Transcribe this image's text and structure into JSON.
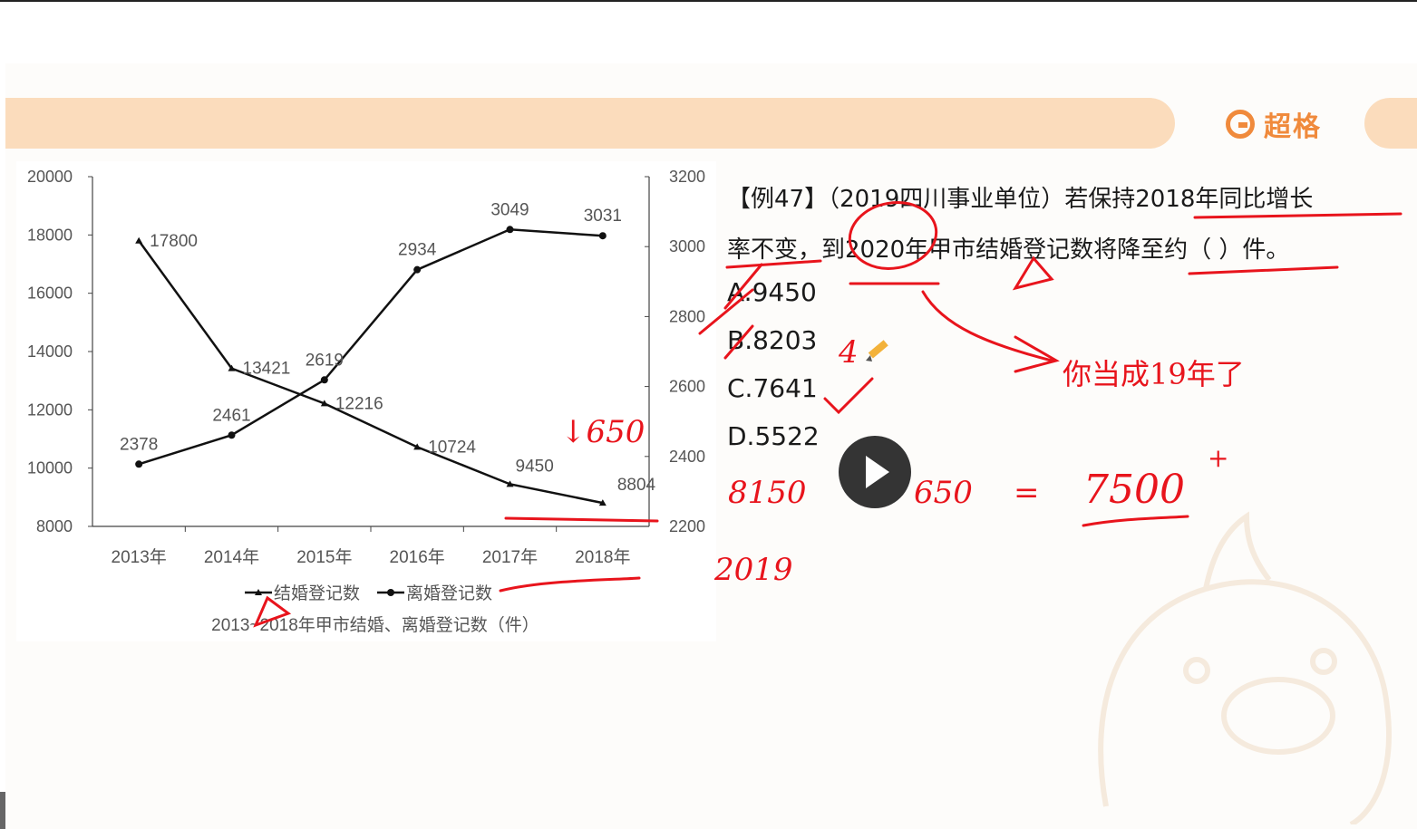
{
  "brand": {
    "name": "超格",
    "accent": "#f08a3c",
    "banner_color": "#fbdcbc"
  },
  "question": {
    "line1": "【例47】（2019四川事业单位）若保持2018年同比增长",
    "line2": "率不变，到2020年甲市结婚登记数将降至约（  ）件。",
    "options": [
      "A.9450",
      "B.8203",
      "C.7641",
      "D.5522"
    ]
  },
  "annotations": {
    "note": "你当成19年了",
    "drop": "↓650",
    "calc_left": "8150",
    "calc_minus": "650",
    "calc_eq": "=",
    "calc_result": "7500",
    "calc_plus": "+",
    "year_note": "2019",
    "mark_4": "4",
    "red_color": "#e8141c"
  },
  "video": {
    "play_icon": "play-icon"
  },
  "chart_data": {
    "type": "line",
    "categories": [
      "2013年",
      "2014年",
      "2015年",
      "2016年",
      "2017年",
      "2018年"
    ],
    "title": "",
    "caption": "2013~2018年甲市结婚、离婚登记数（件）",
    "xlabel": "",
    "ylabel": "",
    "ylim": [
      8000,
      20000
    ],
    "y2lim": [
      2200,
      3200
    ],
    "yticks": [
      "8000",
      "10000",
      "12000",
      "14000",
      "16000",
      "18000",
      "20000"
    ],
    "y2ticks": [
      "2200",
      "2400",
      "2600",
      "2800",
      "3000",
      "3200"
    ],
    "grid": false,
    "legend": "bottom",
    "series": [
      {
        "name": "结婚登记数",
        "axis": "left",
        "marker": "triangle",
        "values": [
          17800,
          13421,
          12216,
          10724,
          9450,
          8804
        ],
        "labels": [
          "17800",
          "13421",
          "12216",
          "10724",
          "9450",
          "8804"
        ]
      },
      {
        "name": "离婚登记数",
        "axis": "right",
        "marker": "circle",
        "values": [
          2378,
          2461,
          2619,
          2934,
          3049,
          3031
        ],
        "labels": [
          "2378",
          "2461",
          "2619",
          "2934",
          "3049",
          "3031"
        ]
      }
    ]
  }
}
